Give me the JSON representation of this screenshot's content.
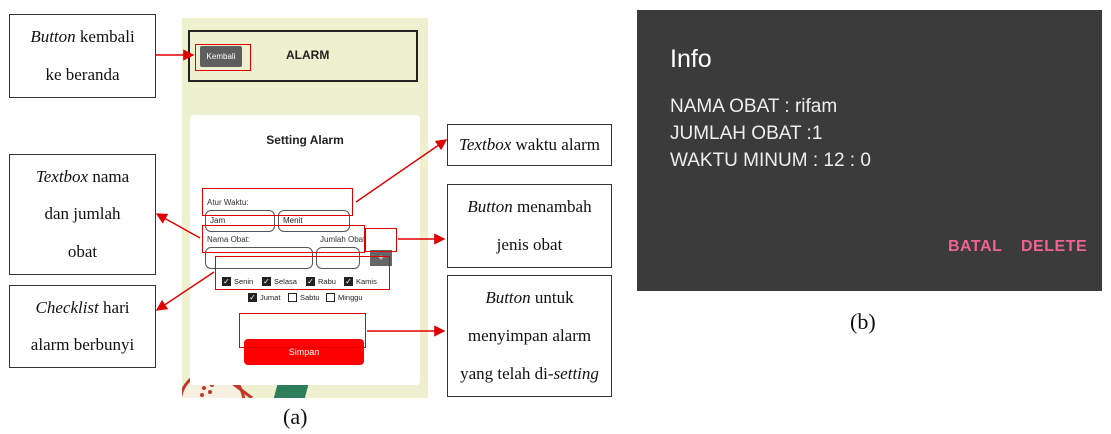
{
  "app": {
    "back_label": "Kembali",
    "title": "ALARM",
    "card_title": "Setting Alarm",
    "atur_waktu_label": "Atur Waktu:",
    "jam_placeholder": "Jam",
    "menit_placeholder": "Menit",
    "nama_obat_label": "Nama Obat:",
    "jumlah_obat_label": "Jumlah Obat",
    "add_label": "+",
    "days": [
      {
        "label": "Senin",
        "checked": true
      },
      {
        "label": "Selasa",
        "checked": true
      },
      {
        "label": "Rabu",
        "checked": true
      },
      {
        "label": "Kamis",
        "checked": true
      },
      {
        "label": "Jumat",
        "checked": true
      },
      {
        "label": "Sabtu",
        "checked": false
      },
      {
        "label": "Minggu",
        "checked": false
      }
    ],
    "save_label": "Simpan"
  },
  "annotations": {
    "back": {
      "em": "Button",
      "line1": " kembali",
      "line2": "ke beranda"
    },
    "names": {
      "em": "Textbox",
      "line1": " nama",
      "line2": "dan jumlah",
      "line3": "obat"
    },
    "checklist": {
      "em": "Checklist",
      "line1": " hari",
      "line2": "alarm berbunyi"
    },
    "time": {
      "em": "Textbox",
      "line1": " waktu alarm"
    },
    "add": {
      "em": "Button",
      "line1": " menambah",
      "line2": "jenis obat"
    },
    "save": {
      "em": "Button",
      "line1": " untuk",
      "line2": "menyimpan alarm",
      "line3": "yang telah di-",
      "em2": "setting"
    }
  },
  "dialog": {
    "title": "Info",
    "lines": [
      "NAMA OBAT : rifam",
      "JUMLAH OBAT :1",
      "WAKTU MINUM : 12 : 0"
    ],
    "cancel_label": "BATAL",
    "delete_label": "DELETE"
  },
  "captions": {
    "a": "(a)",
    "b": "(b)"
  },
  "colors": {
    "annotation_red": "#e00000",
    "save_button": "#ff0000",
    "dialog_bg": "#3b3b3b",
    "dialog_action": "#f06292",
    "phone_bg": "#eef0cf"
  }
}
